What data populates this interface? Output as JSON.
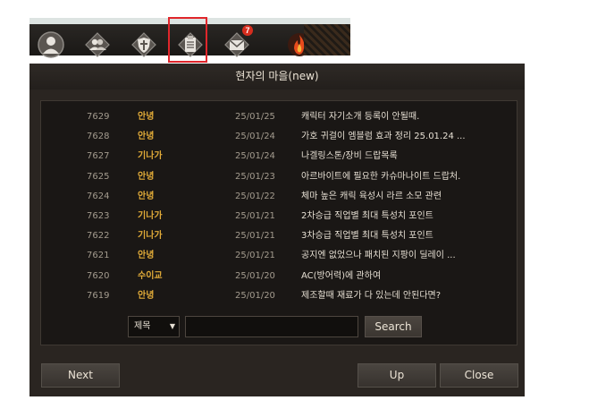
{
  "iconbar": {
    "icons": [
      "profile-icon",
      "friends-icon",
      "guild-shield-icon",
      "notice-board-icon",
      "mail-icon",
      "fire-icon"
    ],
    "mail_badge": "7"
  },
  "dialog": {
    "title": "현자의 마을(new)"
  },
  "posts": [
    {
      "num": "7629",
      "category": "안녕",
      "date": "25/01/25",
      "title": "캐릭터 자기소개 등록이 안될때."
    },
    {
      "num": "7628",
      "category": "안녕",
      "date": "25/01/24",
      "title": "가호 귀걸이 엠블럼 효과 정리 25.01.24 ..."
    },
    {
      "num": "7627",
      "category": "기나가",
      "date": "25/01/24",
      "title": "나겔링스톤/장비 드랍목록"
    },
    {
      "num": "7625",
      "category": "안녕",
      "date": "25/01/23",
      "title": "아르바이트에 필요한 카슈마나이트 드랍처."
    },
    {
      "num": "7624",
      "category": "안녕",
      "date": "25/01/22",
      "title": "체마 높은 캐릭 육성시 라르 소모 관련"
    },
    {
      "num": "7623",
      "category": "기나가",
      "date": "25/01/21",
      "title": "2차승급 직업별 최대 특성치 포인트"
    },
    {
      "num": "7622",
      "category": "기나가",
      "date": "25/01/21",
      "title": "3차승급 직업별 최대 특성치 포인트"
    },
    {
      "num": "7621",
      "category": "안녕",
      "date": "25/01/21",
      "title": "공지엔 없었으나 패치된 지팡이 딜레이 ..."
    },
    {
      "num": "7620",
      "category": "수이교",
      "date": "25/01/20",
      "title": "AC(방어력)에 관하여"
    },
    {
      "num": "7619",
      "category": "안녕",
      "date": "25/01/20",
      "title": "제조할때 재료가 다 있는데 안된다면?"
    }
  ],
  "search": {
    "field_selected": "제목",
    "query": "",
    "button_label": "Search"
  },
  "footer": {
    "next_label": "Next",
    "up_label": "Up",
    "close_label": "Close"
  }
}
